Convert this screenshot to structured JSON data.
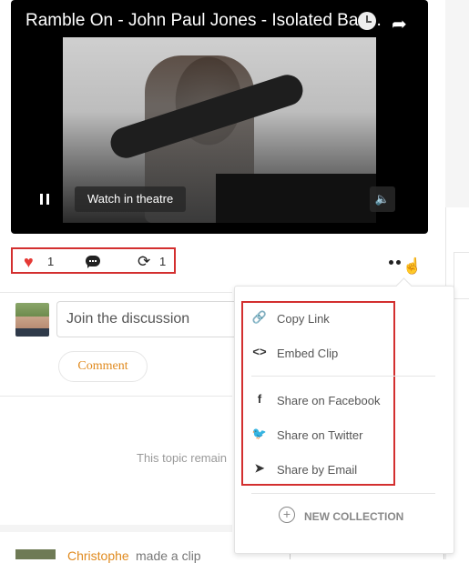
{
  "video": {
    "title": "Ramble On - John Paul Jones - Isolated Bas...",
    "watch_label": "Watch in theatre",
    "icons": {
      "clock": "clock-icon",
      "share": "share-arrow-icon",
      "pause": "pause-icon",
      "volume": "volume-icon"
    }
  },
  "stats": {
    "likes": "1",
    "reposts": "1",
    "icons": {
      "like": "heart-icon",
      "comment": "comment-bubble-icon",
      "repost": "repost-icon",
      "more": "more-dots-icon"
    },
    "like_color": "#e53935"
  },
  "comment": {
    "placeholder": "Join the discussion",
    "button": "Comment"
  },
  "topic_text": "This topic remain",
  "next_post": {
    "author": "Christophe",
    "action": "made a clip"
  },
  "menu": {
    "items": [
      {
        "icon": "link-icon",
        "label": "Copy Link"
      },
      {
        "icon": "embed-code-icon",
        "label": "Embed Clip"
      },
      {
        "icon": "facebook-icon",
        "label": "Share on Facebook"
      },
      {
        "icon": "twitter-icon",
        "label": "Share on Twitter"
      },
      {
        "icon": "send-email-icon",
        "label": "Share by Email"
      }
    ],
    "new_collection": "NEW COLLECTION"
  },
  "colors": {
    "accent": "#e08a1e",
    "highlight": "#d32f2f"
  }
}
